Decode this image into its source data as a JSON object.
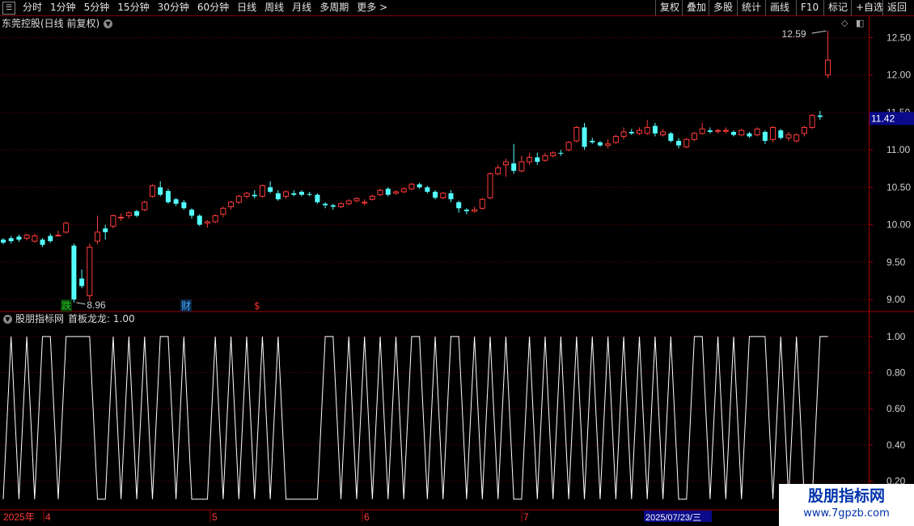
{
  "toolbar": {
    "periods": [
      "分时",
      "1分钟",
      "5分钟",
      "15分钟",
      "30分钟",
      "60分钟",
      "日线",
      "周线",
      "月线",
      "多周期",
      "更多 >"
    ],
    "active_period": "日线",
    "right_buttons": [
      "复权",
      "叠加",
      "多股",
      "统计",
      "画线",
      "F10",
      "标记",
      "+自选",
      "返回"
    ]
  },
  "main_chart": {
    "title": "东莞控股(日线 前复权)",
    "max_label": "12.59",
    "min_label": "8.96",
    "current_price": "11.42",
    "markers": [
      {
        "text": "跌",
        "color": "#22cc22"
      },
      {
        "text": "财",
        "color": "#4aa8ff"
      },
      {
        "text": "$",
        "color": "#ff3030"
      }
    ]
  },
  "indicator": {
    "title": "股朋指标网",
    "name": "首板龙龙: 1.00"
  },
  "dates": {
    "year": "2025年",
    "months": [
      "4",
      "5",
      "6",
      "7"
    ],
    "cursor": "2025/07/23/三"
  },
  "watermark": {
    "line1": "股朋指标网",
    "line2": "www.7gpzb.com"
  },
  "colors": {
    "up": "#ff3b3b",
    "down": "#54ffff",
    "grid": "#7a0000",
    "axis": "#a00000",
    "text": "#d0d0d0"
  },
  "chart_data": {
    "type": "candlestick",
    "title": "东莞控股(日线 前复权)",
    "ylim": [
      8.85,
      12.7
    ],
    "yticks": [
      9.0,
      9.5,
      10.0,
      10.5,
      11.0,
      11.5,
      12.0,
      12.5
    ],
    "candles": [
      [
        9.8,
        9.76,
        9.82,
        9.74
      ],
      [
        9.82,
        9.78,
        9.85,
        9.75
      ],
      [
        9.84,
        9.8,
        9.87,
        9.77
      ],
      [
        9.82,
        9.86,
        9.88,
        9.79
      ],
      [
        9.78,
        9.85,
        9.88,
        9.76
      ],
      [
        9.8,
        9.73,
        9.82,
        9.7
      ],
      [
        9.85,
        9.78,
        9.88,
        9.76
      ],
      [
        9.86,
        9.86,
        9.92,
        9.84
      ],
      [
        9.9,
        10.02,
        10.04,
        9.88
      ],
      [
        9.72,
        9.0,
        9.75,
        8.96
      ],
      [
        9.28,
        9.18,
        9.4,
        9.15
      ],
      [
        9.05,
        9.7,
        9.75,
        8.99
      ],
      [
        9.78,
        9.9,
        10.12,
        9.74
      ],
      [
        9.95,
        9.9,
        10.0,
        9.8
      ],
      [
        9.98,
        10.12,
        10.14,
        9.95
      ],
      [
        10.1,
        10.1,
        10.15,
        10.05
      ],
      [
        10.12,
        10.16,
        10.18,
        10.08
      ],
      [
        10.18,
        10.12,
        10.2,
        10.1
      ],
      [
        10.2,
        10.3,
        10.32,
        10.18
      ],
      [
        10.38,
        10.52,
        10.54,
        10.36
      ],
      [
        10.5,
        10.4,
        10.58,
        10.38
      ],
      [
        10.45,
        10.3,
        10.48,
        10.28
      ],
      [
        10.34,
        10.28,
        10.36,
        10.25
      ],
      [
        10.3,
        10.22,
        10.33,
        10.2
      ],
      [
        10.2,
        10.12,
        10.22,
        10.08
      ],
      [
        10.12,
        10.0,
        10.14,
        9.98
      ],
      [
        10.02,
        10.04,
        10.06,
        9.96
      ],
      [
        10.04,
        10.12,
        10.14,
        10.02
      ],
      [
        10.14,
        10.22,
        10.24,
        10.1
      ],
      [
        10.24,
        10.3,
        10.32,
        10.2
      ],
      [
        10.3,
        10.38,
        10.4,
        10.28
      ],
      [
        10.38,
        10.42,
        10.44,
        10.35
      ],
      [
        10.4,
        10.38,
        10.46,
        10.35
      ],
      [
        10.38,
        10.52,
        10.54,
        10.36
      ],
      [
        10.5,
        10.44,
        10.58,
        10.42
      ],
      [
        10.42,
        10.34,
        10.46,
        10.32
      ],
      [
        10.38,
        10.44,
        10.46,
        10.35
      ],
      [
        10.42,
        10.4,
        10.46,
        10.38
      ],
      [
        10.44,
        10.4,
        10.46,
        10.38
      ],
      [
        10.41,
        10.4,
        10.44,
        10.38
      ],
      [
        10.4,
        10.3,
        10.42,
        10.28
      ],
      [
        10.28,
        10.26,
        10.3,
        10.22
      ],
      [
        10.26,
        10.24,
        10.28,
        10.2
      ],
      [
        10.24,
        10.28,
        10.3,
        10.22
      ],
      [
        10.28,
        10.32,
        10.34,
        10.26
      ],
      [
        10.32,
        10.35,
        10.37,
        10.3
      ],
      [
        10.3,
        10.3,
        10.34,
        10.26
      ],
      [
        10.34,
        10.38,
        10.4,
        10.32
      ],
      [
        10.4,
        10.46,
        10.48,
        10.38
      ],
      [
        10.48,
        10.4,
        10.5,
        10.38
      ],
      [
        10.42,
        10.44,
        10.46,
        10.4
      ],
      [
        10.44,
        10.48,
        10.5,
        10.42
      ],
      [
        10.48,
        10.54,
        10.56,
        10.46
      ],
      [
        10.54,
        10.5,
        10.56,
        10.48
      ],
      [
        10.5,
        10.44,
        10.52,
        10.42
      ],
      [
        10.44,
        10.36,
        10.46,
        10.34
      ],
      [
        10.36,
        10.42,
        10.44,
        10.34
      ],
      [
        10.42,
        10.34,
        10.46,
        10.3
      ],
      [
        10.3,
        10.22,
        10.32,
        10.16
      ],
      [
        10.2,
        10.18,
        10.22,
        10.14
      ],
      [
        10.18,
        10.2,
        10.24,
        10.16
      ],
      [
        10.22,
        10.34,
        10.36,
        10.2
      ],
      [
        10.36,
        10.68,
        10.7,
        10.34
      ],
      [
        10.68,
        10.76,
        10.8,
        10.66
      ],
      [
        10.8,
        10.84,
        10.88,
        10.64
      ],
      [
        10.82,
        10.72,
        11.08,
        10.68
      ],
      [
        10.72,
        10.84,
        10.92,
        10.7
      ],
      [
        10.84,
        10.9,
        10.96,
        10.8
      ],
      [
        10.9,
        10.84,
        10.96,
        10.8
      ],
      [
        10.86,
        10.92,
        10.96,
        10.84
      ],
      [
        10.92,
        10.96,
        10.98,
        10.9
      ],
      [
        10.96,
        10.95,
        11.0,
        10.92
      ],
      [
        11.0,
        11.1,
        11.12,
        10.98
      ],
      [
        11.12,
        11.3,
        11.32,
        11.1
      ],
      [
        11.3,
        11.04,
        11.36,
        11.0
      ],
      [
        11.12,
        11.1,
        11.16,
        11.08
      ],
      [
        11.1,
        11.06,
        11.12,
        11.04
      ],
      [
        11.06,
        11.08,
        11.14,
        11.02
      ],
      [
        11.1,
        11.18,
        11.2,
        11.08
      ],
      [
        11.18,
        11.24,
        11.3,
        11.14
      ],
      [
        11.24,
        11.22,
        11.28,
        11.2
      ],
      [
        11.22,
        11.26,
        11.3,
        11.2
      ],
      [
        11.22,
        11.3,
        11.4,
        11.2
      ],
      [
        11.32,
        11.22,
        11.36,
        11.18
      ],
      [
        11.2,
        11.24,
        11.28,
        11.18
      ],
      [
        11.22,
        11.12,
        11.24,
        11.1
      ],
      [
        11.12,
        11.06,
        11.16,
        11.02
      ],
      [
        11.04,
        11.14,
        11.16,
        11.02
      ],
      [
        11.14,
        11.22,
        11.24,
        11.12
      ],
      [
        11.22,
        11.28,
        11.36,
        11.2
      ],
      [
        11.26,
        11.24,
        11.3,
        11.22
      ],
      [
        11.25,
        11.26,
        11.28,
        11.22
      ],
      [
        11.26,
        11.26,
        11.3,
        11.22
      ],
      [
        11.24,
        11.2,
        11.26,
        11.18
      ],
      [
        11.2,
        11.26,
        11.28,
        11.18
      ],
      [
        11.22,
        11.18,
        11.24,
        11.16
      ],
      [
        11.2,
        11.28,
        11.3,
        11.18
      ],
      [
        11.24,
        11.12,
        11.26,
        11.08
      ],
      [
        11.14,
        11.3,
        11.32,
        11.1
      ],
      [
        11.26,
        11.16,
        11.28,
        11.14
      ],
      [
        11.16,
        11.2,
        11.24,
        11.12
      ],
      [
        11.12,
        11.2,
        11.22,
        11.1
      ],
      [
        11.22,
        11.3,
        11.32,
        11.18
      ],
      [
        11.3,
        11.46,
        11.48,
        11.28
      ],
      [
        11.46,
        11.44,
        11.52,
        11.4
      ],
      [
        12.0,
        12.2,
        12.59,
        11.96
      ]
    ],
    "indicator_ylim": [
      0.05,
      1.08
    ],
    "indicator_yticks": [
      0.2,
      0.4,
      0.6,
      0.8,
      1.0
    ],
    "indicator_values": [
      0,
      1,
      0,
      1,
      0,
      1,
      1,
      0,
      1,
      1,
      1,
      1,
      0,
      0,
      1,
      0,
      1,
      0,
      1,
      0,
      1,
      1,
      0,
      1,
      0,
      0,
      0,
      1,
      0,
      1,
      0,
      1,
      0,
      1,
      0,
      1,
      0,
      0,
      0,
      0,
      0,
      1,
      1,
      0,
      1,
      0,
      1,
      0,
      1,
      0,
      1,
      0,
      1,
      1,
      0,
      1,
      0,
      1,
      1,
      0,
      1,
      0,
      1,
      0,
      1,
      0,
      0,
      1,
      0,
      1,
      0,
      1,
      0,
      1,
      0,
      1,
      0,
      1,
      0,
      1,
      0,
      1,
      0,
      1,
      0,
      1,
      0,
      0,
      1,
      1,
      0,
      1,
      0,
      1,
      0,
      1,
      1,
      1,
      0,
      1,
      0,
      1,
      0,
      0,
      1,
      1
    ]
  }
}
